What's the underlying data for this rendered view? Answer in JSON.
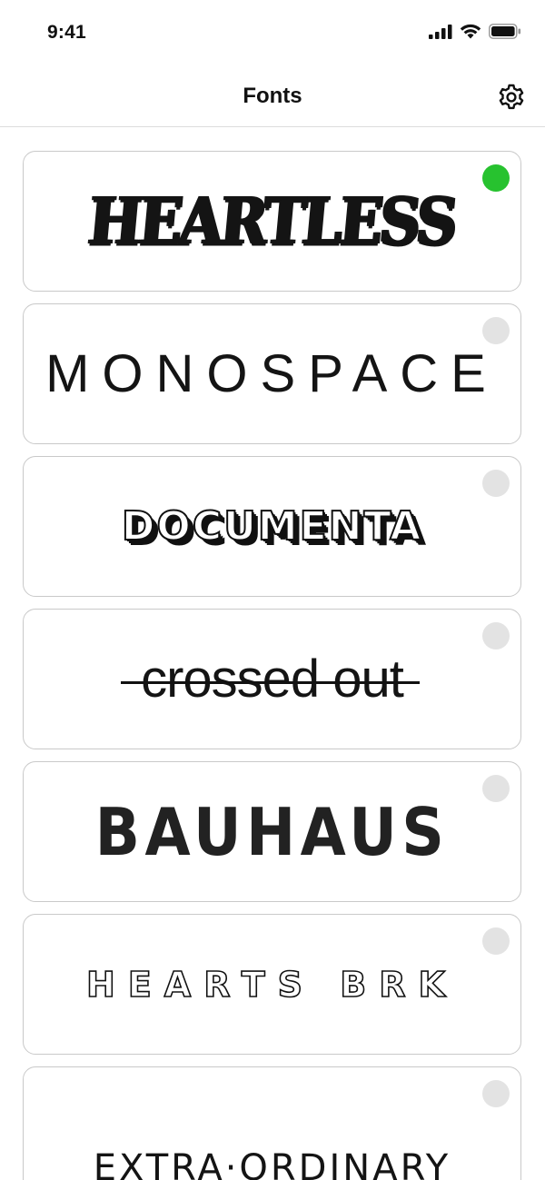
{
  "status": {
    "time": "9:41"
  },
  "nav": {
    "title": "Fonts"
  },
  "fonts": [
    {
      "label": "HEARTLESS",
      "selected": true
    },
    {
      "label": "MONOSPACE",
      "selected": false
    },
    {
      "label": "DOCUMENTA",
      "selected": false
    },
    {
      "label": "crossed out",
      "selected": false
    },
    {
      "label": "BAUHAUS",
      "selected": false
    },
    {
      "label": "HEARTS BRK",
      "selected": false
    },
    {
      "label": "EXTRA·ORDINARY",
      "selected": false
    }
  ],
  "colors": {
    "selected": "#27c22f",
    "unselected": "#e3e3e3",
    "border": "#c9c9c9"
  }
}
